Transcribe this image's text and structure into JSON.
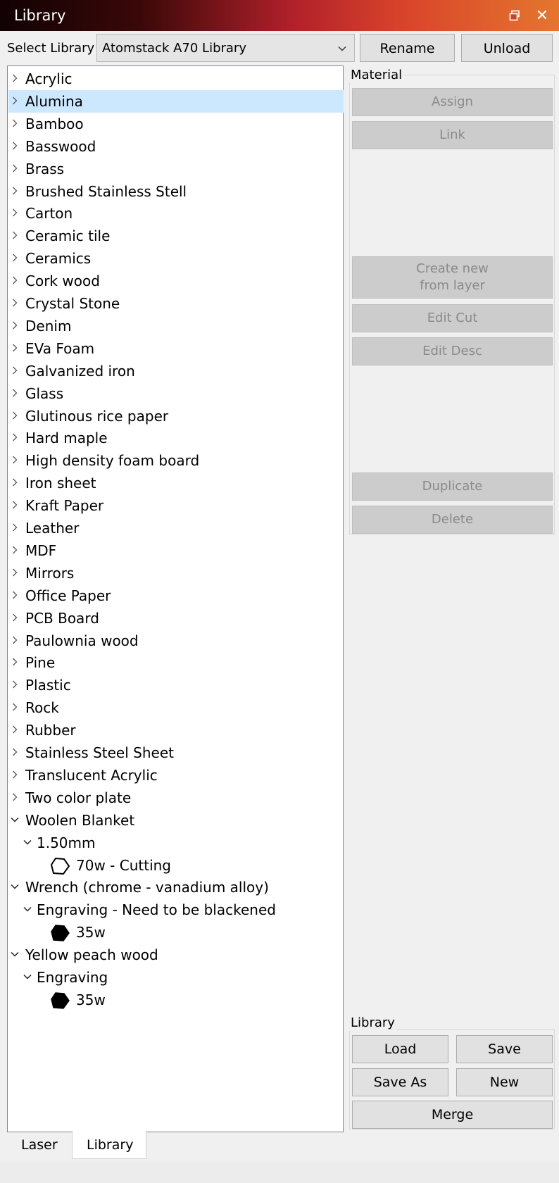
{
  "window": {
    "title": "Library",
    "float_icon": "restore-window-icon",
    "close_glyph": "✕"
  },
  "select_library": {
    "label": "Select Library",
    "value": "Atomstack A70 Library"
  },
  "top_buttons": {
    "rename": "Rename",
    "unload": "Unload"
  },
  "tree": {
    "selected_index": 1,
    "items": [
      {
        "label": "Acrylic",
        "level": 0,
        "expanded": false
      },
      {
        "label": "Alumina",
        "level": 0,
        "expanded": false
      },
      {
        "label": "Bamboo",
        "level": 0,
        "expanded": false
      },
      {
        "label": "Basswood",
        "level": 0,
        "expanded": false
      },
      {
        "label": "Brass",
        "level": 0,
        "expanded": false
      },
      {
        "label": "Brushed Stainless Stell",
        "level": 0,
        "expanded": false
      },
      {
        "label": "Carton",
        "level": 0,
        "expanded": false
      },
      {
        "label": "Ceramic tile",
        "level": 0,
        "expanded": false
      },
      {
        "label": "Ceramics",
        "level": 0,
        "expanded": false
      },
      {
        "label": "Cork wood",
        "level": 0,
        "expanded": false
      },
      {
        "label": "Crystal Stone",
        "level": 0,
        "expanded": false
      },
      {
        "label": "Denim",
        "level": 0,
        "expanded": false
      },
      {
        "label": "EVa Foam",
        "level": 0,
        "expanded": false
      },
      {
        "label": "Galvanized iron",
        "level": 0,
        "expanded": false
      },
      {
        "label": "Glass",
        "level": 0,
        "expanded": false
      },
      {
        "label": "Glutinous rice paper",
        "level": 0,
        "expanded": false
      },
      {
        "label": "Hard maple",
        "level": 0,
        "expanded": false
      },
      {
        "label": "High density foam board",
        "level": 0,
        "expanded": false
      },
      {
        "label": "Iron sheet",
        "level": 0,
        "expanded": false
      },
      {
        "label": "Kraft Paper",
        "level": 0,
        "expanded": false
      },
      {
        "label": "Leather",
        "level": 0,
        "expanded": false
      },
      {
        "label": "MDF",
        "level": 0,
        "expanded": false
      },
      {
        "label": "Mirrors",
        "level": 0,
        "expanded": false
      },
      {
        "label": "Office Paper",
        "level": 0,
        "expanded": false
      },
      {
        "label": "PCB Board",
        "level": 0,
        "expanded": false
      },
      {
        "label": "Paulownia wood",
        "level": 0,
        "expanded": false
      },
      {
        "label": "Pine",
        "level": 0,
        "expanded": false
      },
      {
        "label": "Plastic",
        "level": 0,
        "expanded": false
      },
      {
        "label": "Rock",
        "level": 0,
        "expanded": false
      },
      {
        "label": "Rubber",
        "level": 0,
        "expanded": false
      },
      {
        "label": "Stainless Steel Sheet",
        "level": 0,
        "expanded": false
      },
      {
        "label": "Translucent Acrylic",
        "level": 0,
        "expanded": false
      },
      {
        "label": "Two color plate",
        "level": 0,
        "expanded": false
      },
      {
        "label": "Woolen Blanket",
        "level": 0,
        "expanded": true
      },
      {
        "label": "1.50mm",
        "level": 1,
        "expanded": true
      },
      {
        "label": "70w - Cutting",
        "level": 2,
        "leaf": "cut-layer-icon"
      },
      {
        "label": "Wrench (chrome - vanadium alloy)",
        "level": 0,
        "expanded": true
      },
      {
        "label": "Engraving - Need to be blackened",
        "level": 1,
        "expanded": true
      },
      {
        "label": "35w",
        "level": 2,
        "leaf": "fill-layer-icon"
      },
      {
        "label": "Yellow peach wood",
        "level": 0,
        "expanded": true
      },
      {
        "label": "Engraving",
        "level": 1,
        "expanded": true
      },
      {
        "label": "35w",
        "level": 2,
        "leaf": "fill-layer-icon"
      }
    ]
  },
  "material_group": {
    "title": "Material",
    "assign": "Assign",
    "link": "Link",
    "create_new_line1": "Create new",
    "create_new_line2": "from layer",
    "edit_cut": "Edit Cut",
    "edit_desc": "Edit Desc",
    "duplicate": "Duplicate",
    "delete": "Delete"
  },
  "library_group": {
    "title": "Library",
    "load": "Load",
    "save": "Save",
    "save_as": "Save As",
    "new": "New",
    "merge": "Merge"
  },
  "tabs": {
    "laser": "Laser",
    "library": "Library",
    "active": "library"
  },
  "colors": {
    "selection": "#cce8ff",
    "disabled_button_bg": "#cccccc",
    "disabled_text": "#8a8a8a"
  }
}
